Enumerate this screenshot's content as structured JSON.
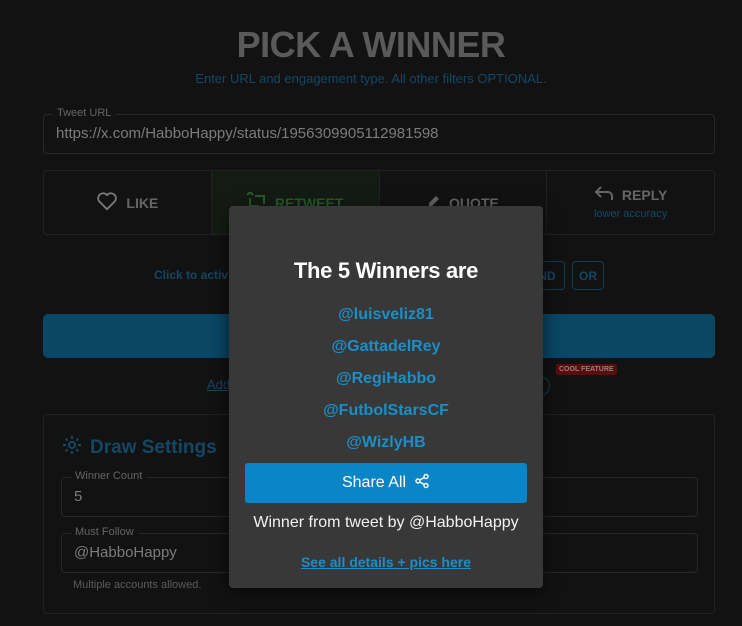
{
  "header": {
    "title": "PICK A WINNER",
    "subtitle": "Enter URL and engagement type. All other filters OPTIONAL."
  },
  "tweet_url": {
    "label": "Tweet URL",
    "value": "https://x.com/HabboHappy/status/1956309905112981598"
  },
  "engagement": {
    "like": "LIKE",
    "retweet": "RETWEET",
    "quote": "QUOTE",
    "reply": "REPLY",
    "reply_note": "lower accuracy"
  },
  "filter_hint": "Click to activ",
  "logic": {
    "and": "ND",
    "or": "OR"
  },
  "add_link": "Add",
  "cool_badge": "COOL FEATURE",
  "draw_settings": {
    "title": "Draw Settings",
    "winner_count_label": "Winner Count",
    "winner_count_value": "5",
    "must_follow_label": "Must Follow",
    "must_follow_value": "@HabboHappy",
    "note": "Multiple accounts allowed."
  },
  "modal": {
    "title": "The 5 Winners are",
    "winners": [
      "@luisveliz81",
      "@GattadelRey",
      "@RegiHabbo",
      "@FutbolStarsCF",
      "@WizlyHB"
    ],
    "share_label": "Share All",
    "from_text": "Winner from tweet by @HabboHappy",
    "details_link": "See all details + pics here"
  },
  "colors": {
    "accent": "#1a8fc7",
    "button": "#0a86c7",
    "modal_bg": "#383838",
    "page_bg": "#1c1c1c"
  }
}
